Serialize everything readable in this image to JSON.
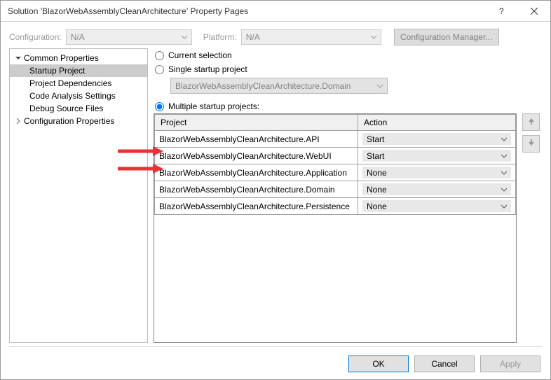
{
  "window": {
    "title": "Solution 'BlazorWebAssemblyCleanArchitecture' Property Pages"
  },
  "config": {
    "label_config": "Configuration:",
    "combo_config": "N/A",
    "label_platform": "Platform:",
    "combo_platform": "N/A",
    "btn_manager": "Configuration Manager..."
  },
  "tree": {
    "root1": "Common Properties",
    "items": [
      "Startup Project",
      "Project Dependencies",
      "Code Analysis Settings",
      "Debug Source Files"
    ],
    "root2": "Configuration Properties"
  },
  "startup": {
    "opt_current": "Current selection",
    "opt_single": "Single startup project",
    "single_value": "BlazorWebAssemblyCleanArchitecture.Domain",
    "opt_multiple": "Multiple startup projects:",
    "col_project": "Project",
    "col_action": "Action",
    "rows": [
      {
        "project": "BlazorWebAssemblyCleanArchitecture.API",
        "action": "Start"
      },
      {
        "project": "BlazorWebAssemblyCleanArchitecture.WebUI",
        "action": "Start"
      },
      {
        "project": "BlazorWebAssemblyCleanArchitecture.Application",
        "action": "None"
      },
      {
        "project": "BlazorWebAssemblyCleanArchitecture.Domain",
        "action": "None"
      },
      {
        "project": "BlazorWebAssemblyCleanArchitecture.Persistence",
        "action": "None"
      }
    ]
  },
  "footer": {
    "ok": "OK",
    "cancel": "Cancel",
    "apply": "Apply"
  }
}
